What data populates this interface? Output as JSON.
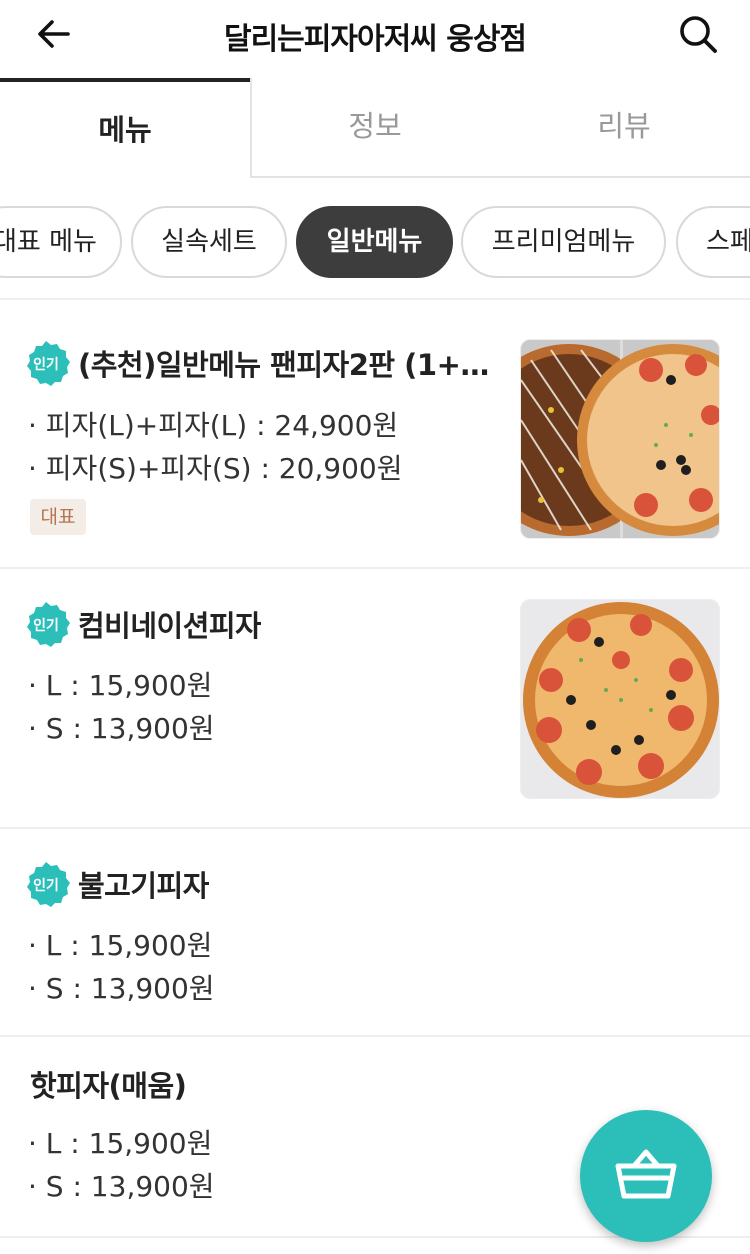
{
  "header": {
    "title": "달리는피자아저씨 웅상점",
    "back_icon": "arrow-left-icon",
    "search_icon": "search-icon"
  },
  "tabs": [
    {
      "label": "메뉴",
      "active": true
    },
    {
      "label": "정보",
      "active": false
    },
    {
      "label": "리뷰",
      "active": false
    }
  ],
  "categories": [
    {
      "label": "대표 메뉴",
      "active": false
    },
    {
      "label": "실속세트",
      "active": false
    },
    {
      "label": "일반메뉴",
      "active": true
    },
    {
      "label": "프리미엄메뉴",
      "active": false
    },
    {
      "label": "스페",
      "active": false
    }
  ],
  "menu_items": [
    {
      "badge": "인기",
      "name": "(추천)일반메뉴 팬피자2판 (1+1…",
      "prices": [
        "· 피자(L)+피자(L) : 24,900원",
        "· 피자(S)+피자(S) : 20,900원"
      ],
      "tag": "대표",
      "has_image": true
    },
    {
      "badge": "인기",
      "name": "컴비네이션피자",
      "prices": [
        "· L : 15,900원",
        "· S : 13,900원"
      ],
      "has_image": true
    },
    {
      "badge": "인기",
      "name": "불고기피자",
      "prices": [
        "· L : 15,900원",
        "· S : 13,900원"
      ],
      "has_image": false
    },
    {
      "name": "핫피자(매움)",
      "prices": [
        "· L : 15,900원",
        "· S : 13,900원"
      ],
      "has_image": false
    }
  ],
  "colors": {
    "accent": "#2cbfb9",
    "active_chip": "#3d3d3d",
    "tag_bg": "#f4ece6",
    "tag_text": "#b5764f"
  },
  "cart_icon": "basket-icon"
}
